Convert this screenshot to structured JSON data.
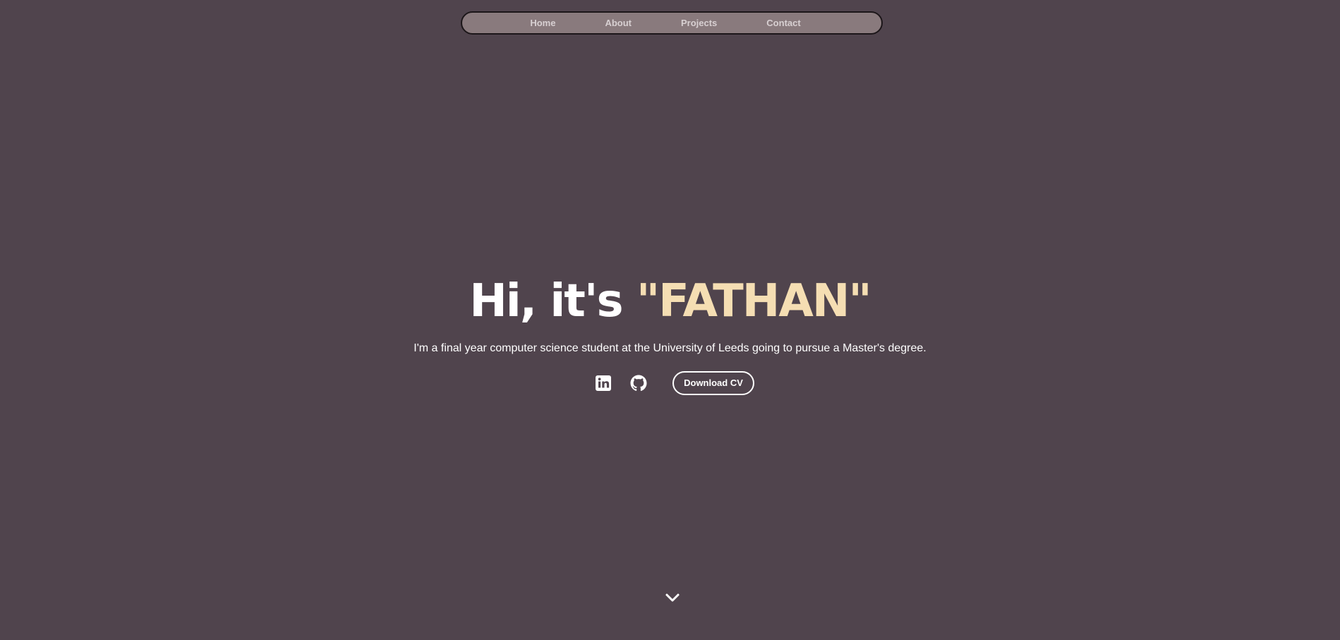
{
  "nav": {
    "items": [
      {
        "label": "Home"
      },
      {
        "label": "About"
      },
      {
        "label": "Projects"
      },
      {
        "label": "Contact"
      }
    ]
  },
  "hero": {
    "greeting": "Hi, it's ",
    "name": "\"FATHAN\"",
    "subtitle": "I'm a final year computer science student at the University of Leeds going to pursue a Master's degree.",
    "download_label": "Download CV"
  },
  "icons": {
    "linkedin": "linkedin-icon",
    "github": "github-icon",
    "scroll": "chevron-down-icon"
  },
  "colors": {
    "background": "#50444d",
    "navbar": "#897a7d",
    "accent": "#f5deb3",
    "text": "#ffffff"
  }
}
